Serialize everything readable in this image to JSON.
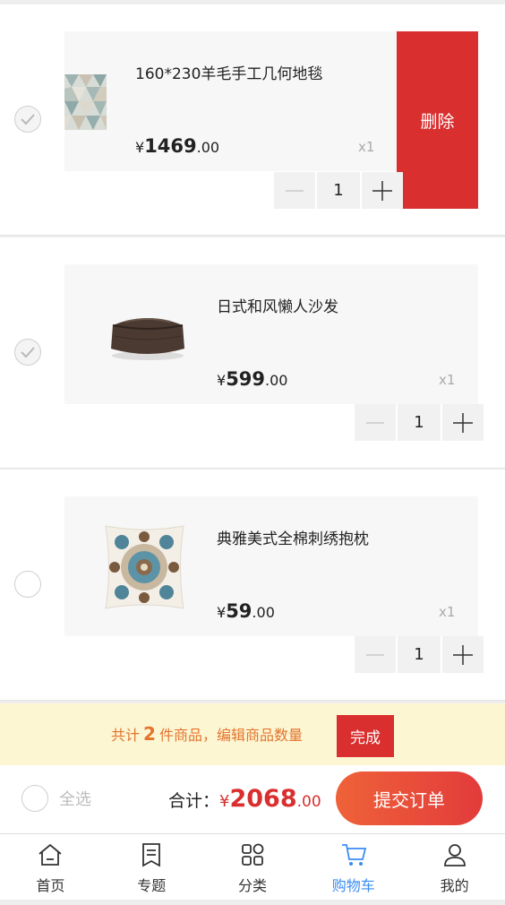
{
  "cart": {
    "items": [
      {
        "name": "160*230羊毛手工几何地毯",
        "currency": "¥",
        "price_int": "1469",
        "price_dec": ".00",
        "qty_label": "x1",
        "quantity": "1",
        "selected": true,
        "delete_label": "删除"
      },
      {
        "name": "日式和风懒人沙发",
        "currency": "¥",
        "price_int": "599",
        "price_dec": ".00",
        "qty_label": "x1",
        "quantity": "1",
        "selected": true
      },
      {
        "name": "典雅美式全棉刺绣抱枕",
        "currency": "¥",
        "price_int": "59",
        "price_dec": ".00",
        "qty_label": "x1",
        "quantity": "1",
        "selected": false
      }
    ]
  },
  "summary": {
    "prefix": "共计",
    "count": "2",
    "suffix": "件商品，编辑商品数量",
    "done_label": "完成"
  },
  "checkout": {
    "select_all_label": "全选",
    "total_label": "合计：",
    "currency": "¥",
    "total_int": "2068",
    "total_dec": ".00",
    "submit_label": "提交订单"
  },
  "tabbar": {
    "tabs": [
      {
        "label": "首页",
        "icon": "home-icon",
        "active": false
      },
      {
        "label": "专题",
        "icon": "topic-icon",
        "active": false
      },
      {
        "label": "分类",
        "icon": "category-icon",
        "active": false
      },
      {
        "label": "购物车",
        "icon": "cart-icon",
        "active": true
      },
      {
        "label": "我的",
        "icon": "user-icon",
        "active": false
      }
    ]
  },
  "colors": {
    "accent_red": "#d92f2f",
    "active_blue": "#3b8cf5",
    "notice_bg": "#fdf6d3",
    "notice_text": "#e3742e"
  }
}
